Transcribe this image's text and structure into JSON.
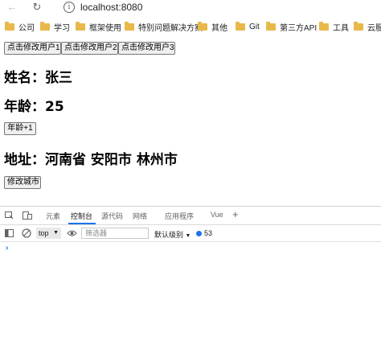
{
  "browser": {
    "url": "localhost:8080",
    "back_icon": "arrow-left-icon",
    "reload_icon": "reload-icon",
    "info_icon": "info-icon"
  },
  "bookmarks": [
    {
      "label": "公司"
    },
    {
      "label": "学习"
    },
    {
      "label": "框架使用"
    },
    {
      "label": "特别问题解决方案"
    },
    {
      "label": "其他"
    },
    {
      "label": "Git"
    },
    {
      "label": "第三方API"
    },
    {
      "label": "工具"
    },
    {
      "label": "云服"
    }
  ],
  "page": {
    "buttons_top": [
      {
        "label": "点击修改用户1"
      },
      {
        "label": "点击修改用户2"
      },
      {
        "label": "点击修改用户3"
      }
    ],
    "name_text": "姓名：张三",
    "age_text": "年龄：25",
    "age_button": "年龄+1",
    "address_text": "地址：河南省 安阳市 林州市",
    "city_button": "修改城市"
  },
  "devtools": {
    "tabs": [
      {
        "label": "元素"
      },
      {
        "label": "控制台"
      },
      {
        "label": "源代码"
      },
      {
        "label": "网络"
      },
      {
        "label": "应用程序"
      },
      {
        "label": "Vue"
      }
    ],
    "add_tab": "+",
    "context": "top",
    "filter_placeholder": "筛选器",
    "level": "默认级别",
    "issues_count": "53",
    "prompt": "›",
    "accent_color": "#1a73e8"
  }
}
